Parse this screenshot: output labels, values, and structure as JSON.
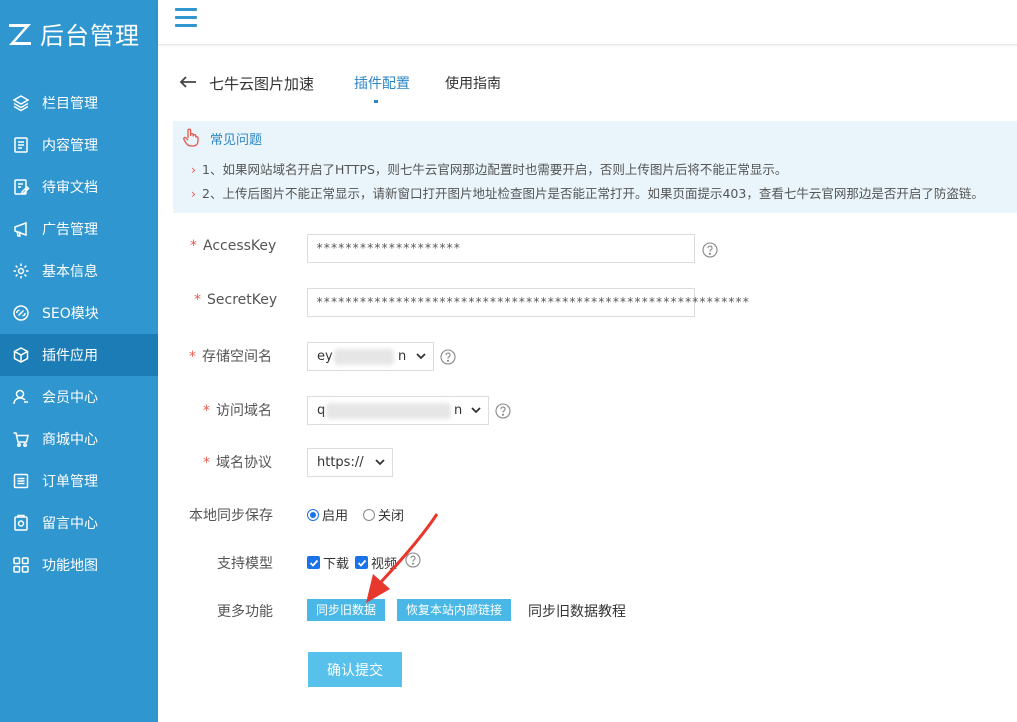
{
  "app": {
    "title": "后台管理"
  },
  "sidebar": {
    "items": [
      {
        "label": "栏目管理",
        "icon": "layers-icon"
      },
      {
        "label": "内容管理",
        "icon": "document-icon"
      },
      {
        "label": "待审文档",
        "icon": "edit-document-icon"
      },
      {
        "label": "广告管理",
        "icon": "ad-icon"
      },
      {
        "label": "基本信息",
        "icon": "gear-icon"
      },
      {
        "label": "SEO模块",
        "icon": "link-icon"
      },
      {
        "label": "插件应用",
        "icon": "cube-icon",
        "active": true
      },
      {
        "label": "会员中心",
        "icon": "user-icon"
      },
      {
        "label": "商城中心",
        "icon": "cart-icon"
      },
      {
        "label": "订单管理",
        "icon": "list-icon"
      },
      {
        "label": "留言中心",
        "icon": "message-icon"
      },
      {
        "label": "功能地图",
        "icon": "grid-icon"
      }
    ]
  },
  "header": {
    "page_title": "七牛云图片加速",
    "tabs": [
      {
        "label": "插件配置",
        "active": true
      },
      {
        "label": "使用指南",
        "active": false
      }
    ]
  },
  "faq": {
    "title": "常见问题",
    "lines": [
      "1、如果网站域名开启了HTTPS，则七牛云官网那边配置时也需要开启，否则上传图片后将不能正常显示。",
      "2、上传后图片不能正常显示，请新窗口打开图片地址检查图片是否能正常打开。如果页面提示403，查看七牛云官网那边是否开启了防盗链。"
    ]
  },
  "form": {
    "access_key": {
      "label": "AccessKey",
      "value": "********************",
      "required": true
    },
    "secret_key": {
      "label": "SecretKey",
      "value": "************************************************************",
      "required": true
    },
    "bucket": {
      "label": "存储空间名",
      "value_start": "ey",
      "value_end": "n",
      "required": true
    },
    "domain": {
      "label": "访问域名",
      "value_start": "q",
      "value_end": "n",
      "required": true
    },
    "protocol": {
      "label": "域名协议",
      "value": "https://",
      "required": true
    },
    "local_sync": {
      "label": "本地同步保存",
      "options": [
        "启用",
        "关闭"
      ],
      "selected": "启用"
    },
    "models": {
      "label": "支持模型",
      "options": [
        "下载",
        "视频"
      ],
      "checked": [
        "下载",
        "视频"
      ]
    },
    "more": {
      "label": "更多功能",
      "sync_button": "同步旧数据",
      "restore_button": "恢复本站内部链接",
      "tutorial_link": "同步旧数据教程"
    },
    "submit_label": "确认提交"
  },
  "colors": {
    "sidebar_bg": "#2f96cf",
    "sidebar_active": "#1c7db6",
    "accent": "#2f86c4",
    "button": "#4ab8e6",
    "required": "#e65a4c",
    "annotation_arrow": "#e8372c"
  }
}
